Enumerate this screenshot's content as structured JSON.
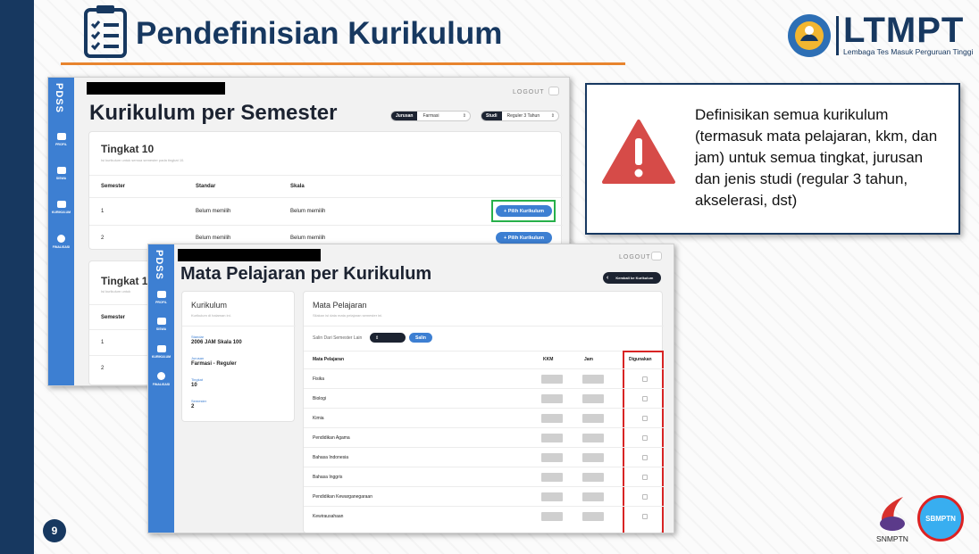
{
  "slide": {
    "title": "Pendefinisian Kurikulum",
    "page_number": "9",
    "logo_main": "LTMPT",
    "logo_sub": "Lembaga Tes Masuk Perguruan Tinggi",
    "callout_text": "Definisikan semua kurikulum (termasuk mata pelajaran, kkm, dan jam) untuk semua tingkat, jurusan dan jenis studi (regular 3 tahun, akselerasi, dst)",
    "footer_logo_left": "SNMPTN",
    "footer_logo_right": "SBMPTN",
    "colors": {
      "navy": "#173860",
      "orange": "#e8842e",
      "warning_red": "#d64b48",
      "app_blue": "#3d7fd2",
      "highlight_green": "#27b04a",
      "highlight_red": "#d82424"
    }
  },
  "app": {
    "logo": "PDSS",
    "logout": "LOGOUT",
    "sidebar": [
      {
        "label": "PROFIL",
        "icon": "pencil-icon"
      },
      {
        "label": "SISWA",
        "icon": "users-icon"
      },
      {
        "label": "KURIKULUM",
        "icon": "book-icon"
      },
      {
        "label": "FINALISASI",
        "icon": "check-circle-icon"
      }
    ]
  },
  "screen1": {
    "title": "Kurikulum per Semester",
    "filter_jurusan_label": "Jurusan",
    "filter_jurusan_value": "Farmasi",
    "filter_studi_label": "Studi",
    "filter_studi_value": "Reguler 3 Tahun",
    "card1_title": "Tingkat 10",
    "card1_subtitle": "Isi kurikulum untuk semua semester pada tingkat 10.",
    "col_semester": "Semester",
    "col_standar": "Standar",
    "col_skala": "Skala",
    "rows": [
      {
        "semester": "1",
        "standar": "Belum memilih",
        "skala": "Belum memilih",
        "action": "+ Pilih Kurikulum"
      },
      {
        "semester": "2",
        "standar": "Belum memilih",
        "skala": "Belum memilih",
        "action": "+ Pilih Kurikulum"
      }
    ],
    "card2_title": "Tingkat 11",
    "card2_subtitle": "Isi kurikulum untuk",
    "card2_col": "Semester",
    "card2_rows": [
      "1",
      "2"
    ]
  },
  "screen2": {
    "title": "Mata Pelajaran per Kurikulum",
    "back_button": "Kembali ke Kurikulum",
    "kurikulum_title": "Kurikulum",
    "kurikulum_subtitle": "Kurikulum di halaman ini.",
    "fields": [
      {
        "key": "Standar",
        "value": "2006 JAM Skala 100"
      },
      {
        "key": "Jurusan",
        "value": "Farmasi - Reguler"
      },
      {
        "key": "Tingkat",
        "value": "10"
      },
      {
        "key": "Semester",
        "value": "2"
      }
    ],
    "mapel_title": "Mata Pelajaran",
    "mapel_subtitle": "Silakan isi data mata pelajaran semester ini.",
    "copy_label": "Salin Dari Semester Lain",
    "copy_button": "Salin",
    "col_mapel": "Mata Pelajaran",
    "col_kkm": "KKM",
    "col_jam": "Jam",
    "col_digunakan": "Digunakan",
    "subjects": [
      "Fisika",
      "Biologi",
      "Kimia",
      "Pendidikan Agama",
      "Bahasa Indonesia",
      "Bahasa Inggris",
      "Pendidikan Kewarganegaraan",
      "Kewirausahaan"
    ]
  }
}
